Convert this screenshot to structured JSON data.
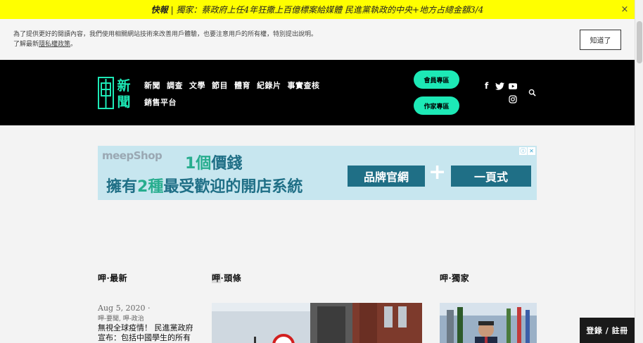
{
  "breaking": {
    "label": "快報",
    "text": "| 獨家：蔡政府上任4年狂撒上百億標案給媒體 民進黨執政的中央+地方占總金額3/4",
    "close": "×"
  },
  "cookie": {
    "line1": "為了提供更好的閱讀內容，我們使用相關網站技術來改善用戶體驗，也要注意用戶的所有權，特別提出說明。",
    "line2_prefix": "了解最新",
    "line2_link": "隱私權政策",
    "line2_suffix": "。",
    "button": "知道了"
  },
  "header": {
    "logo_text": [
      "新",
      "聞"
    ],
    "nav_row1": [
      "新聞",
      "調查",
      "文學",
      "節目",
      "體育",
      "紀錄片",
      "事實查核"
    ],
    "nav_row2": [
      "銷售平台"
    ],
    "member_button": "會員專區",
    "author_button": "作家專區",
    "social_icons": [
      "facebook-icon",
      "twitter-icon",
      "youtube-icon",
      "instagram-icon",
      "search-icon"
    ],
    "accent_color": "#1de9b6"
  },
  "ad": {
    "brand": "meepShop",
    "line1_a": "1個",
    "line1_b": "價錢",
    "line2_a": "擁有",
    "line2_b": "2種",
    "line2_c": "最受歡迎的開店系統",
    "box1": "品牌官網",
    "plus": "+",
    "box2": "一頁式"
  },
  "sections": {
    "latest": "呷·最新",
    "headline_hl": "呷",
    "headline_rest": "·頭條",
    "exclusive": "呷·獨家"
  },
  "latest_article": {
    "date": "Aug 5, 2020 ·",
    "categories": "呷-要聞, 呷-政治",
    "title": "無視全球疫情！ 民進黨政府宣布：包括中國學生的所有境外生全都可以回台"
  },
  "login_button": "登錄 / 註冊"
}
